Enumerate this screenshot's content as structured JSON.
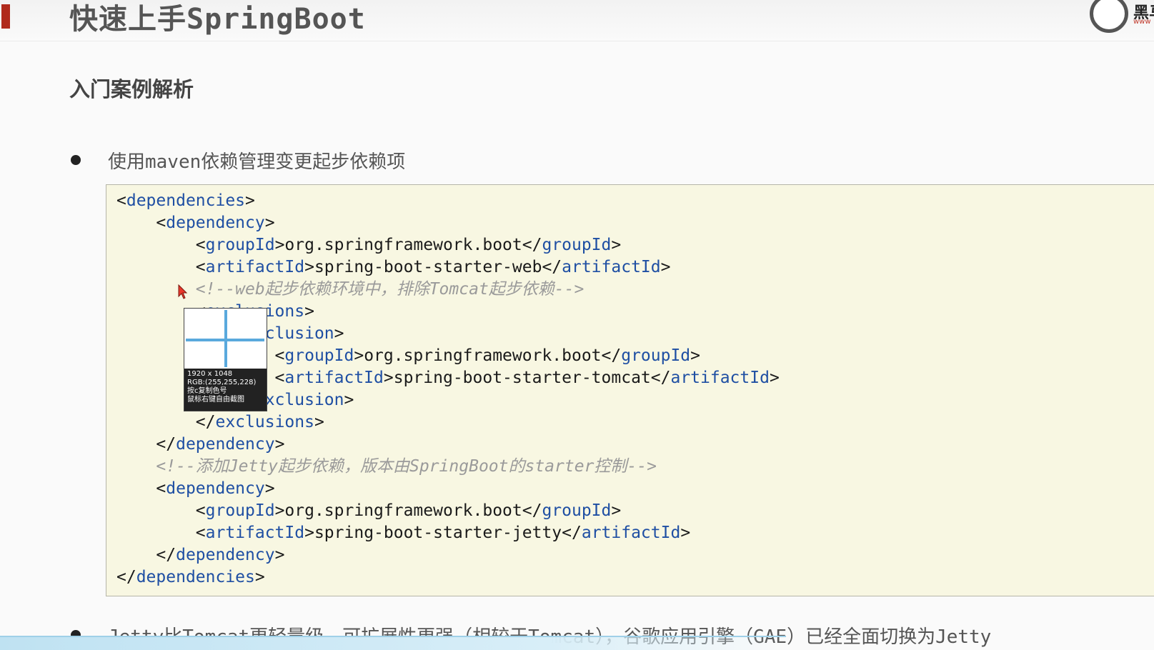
{
  "slide": {
    "title": "快速上手SpringBoot",
    "section_title": "入门案例解析",
    "logo_text": "黑马",
    "logo_sub": "www",
    "bullets": [
      "使用maven依赖管理变更起步依赖项",
      "Jetty比Tomcat更轻量级，可扩展性更强（相较于Tomcat），谷歌应用引擎（GAE）已经全面切换为Jetty"
    ]
  },
  "code": {
    "lines": [
      [
        "<",
        "dependencies",
        ">"
      ],
      [
        "    <",
        "dependency",
        ">"
      ],
      [
        "        <",
        "groupId",
        ">org.springframework.boot</",
        "groupId",
        ">"
      ],
      [
        "        <",
        "artifactId",
        ">spring-boot-starter-web</",
        "artifactId",
        ">"
      ],
      [
        "        <!--web起步依赖环境中，排除Tomcat起步依赖-->"
      ],
      [
        "        <",
        "exclusions",
        ">"
      ],
      [
        "            <",
        "exclusion",
        ">"
      ],
      [
        "                <",
        "groupId",
        ">org.springframework.boot</",
        "groupId",
        ">"
      ],
      [
        "                <",
        "artifactId",
        ">spring-boot-starter-tomcat</",
        "artifactId",
        ">"
      ],
      [
        "            </",
        "exclusion",
        ">"
      ],
      [
        "        </",
        "exclusions",
        ">"
      ],
      [
        "    </",
        "dependency",
        ">"
      ],
      [
        "    <!--添加Jetty起步依赖，版本由SpringBoot的starter控制-->"
      ],
      [
        "    <",
        "dependency",
        ">"
      ],
      [
        "        <",
        "groupId",
        ">org.springframework.boot</",
        "groupId",
        ">"
      ],
      [
        "        <",
        "artifactId",
        ">spring-boot-starter-jetty</",
        "artifactId",
        ">"
      ],
      [
        "    </",
        "dependency",
        ">"
      ],
      [
        "</",
        "dependencies",
        ">"
      ]
    ]
  },
  "color_picker": {
    "size": "1920 x 1048",
    "rgb": "RGB:(255,255,228)",
    "hint1": "按c复制色号",
    "hint2": "鼠标右键自由截图"
  },
  "colors": {
    "code_background": "#f8f7e2",
    "tag_name": "#1f4fa3",
    "comment": "#9a9a9a",
    "crosshair": "#5aa9dd"
  }
}
